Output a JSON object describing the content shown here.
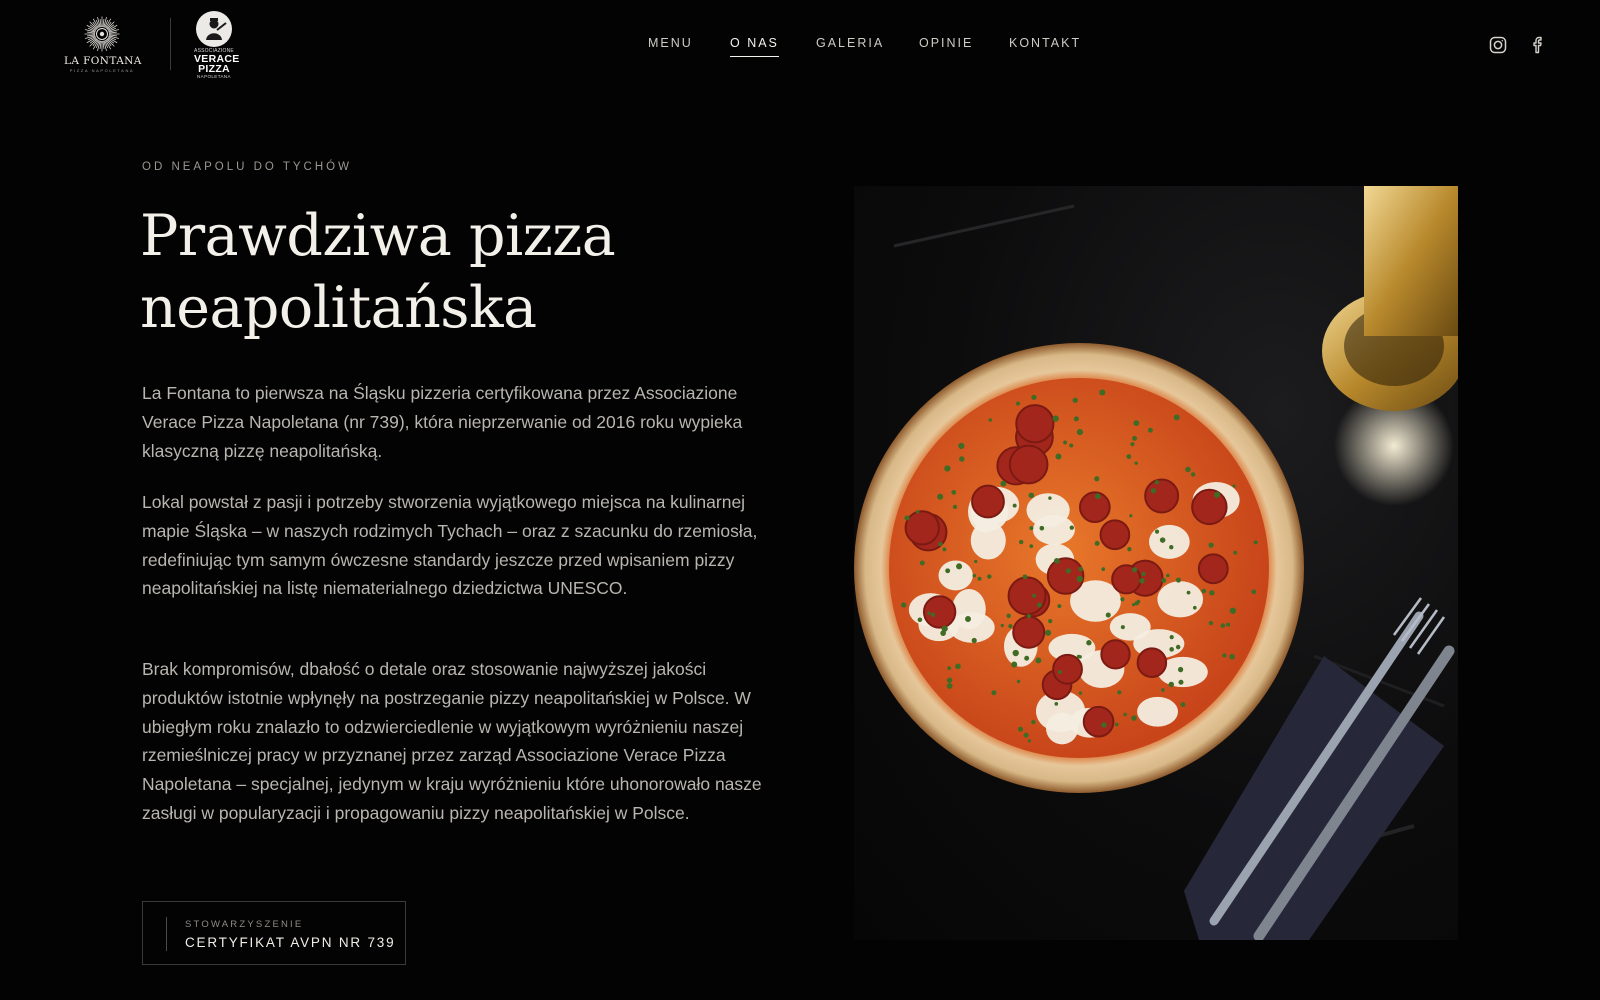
{
  "header": {
    "logo": {
      "name": "LA FONTANA",
      "tagline": "PIZZA NAPOLETANA"
    },
    "partner_logo": {
      "top": "ASSOCIAZIONE",
      "word1": "VERACE",
      "word2": "PIZZA",
      "bottom": "NAPOLETANA"
    },
    "nav": [
      {
        "label": "MENU",
        "active": false
      },
      {
        "label": "O NAS",
        "active": true
      },
      {
        "label": "GALERIA",
        "active": false
      },
      {
        "label": "OPINIE",
        "active": false
      },
      {
        "label": "KONTAKT",
        "active": false
      }
    ],
    "social": [
      "instagram-icon",
      "facebook-icon"
    ]
  },
  "hero": {
    "eyebrow": "OD NEAPOLU DO TYCHÓW",
    "title_line1": "Prawdziwa pizza",
    "title_line2": "neapolitańska",
    "paragraphs": [
      "La Fontana to pierwsza na Śląsku pizzeria certyfikowana przez Associazione Verace Pizza Napoletana (nr 739), która nieprzerwanie od 2016 roku wypieka klasyczną pizzę neapolitańską.",
      "Lokal powstał z pasji i potrzeby stworzenia wyjątkowego miejsca na kulinarnej mapie Śląska – w naszych rodzimych Tychach – oraz z szacunku do rzemiosła, redefiniując tym samym ówczesne standardy jeszcze przed wpisaniem pizzy neapolitańskiej na listę niematerialnego dziedzictwa UNESCO.",
      "Brak kompromisów, dbałość o detale oraz stosowanie najwyższej jakości produktów istotnie wpłynęły na postrzeganie pizzy neapolitańskiej w Polsce. W ubiegłym roku znalazło to odzwierciedlenie w wyjątkowym wyróżnieniu naszej rzemieślniczej pracy w przyznanej przez zarząd Associazione Verace Pizza Napoletana – specjalnej, jedynym w kraju wyróżnieniu które uhonorowało nasze zasługi w popularyzacji i propagowaniu pizzy neapolitańskiej w Polsce."
    ],
    "certificate": {
      "kicker": "STOWARZYSZENIE",
      "label": "CERTYFIKAT AVPN NR 739"
    }
  },
  "colors": {
    "background": "#030304",
    "text": "#e9e6e1",
    "muted": "#b9b5af"
  }
}
